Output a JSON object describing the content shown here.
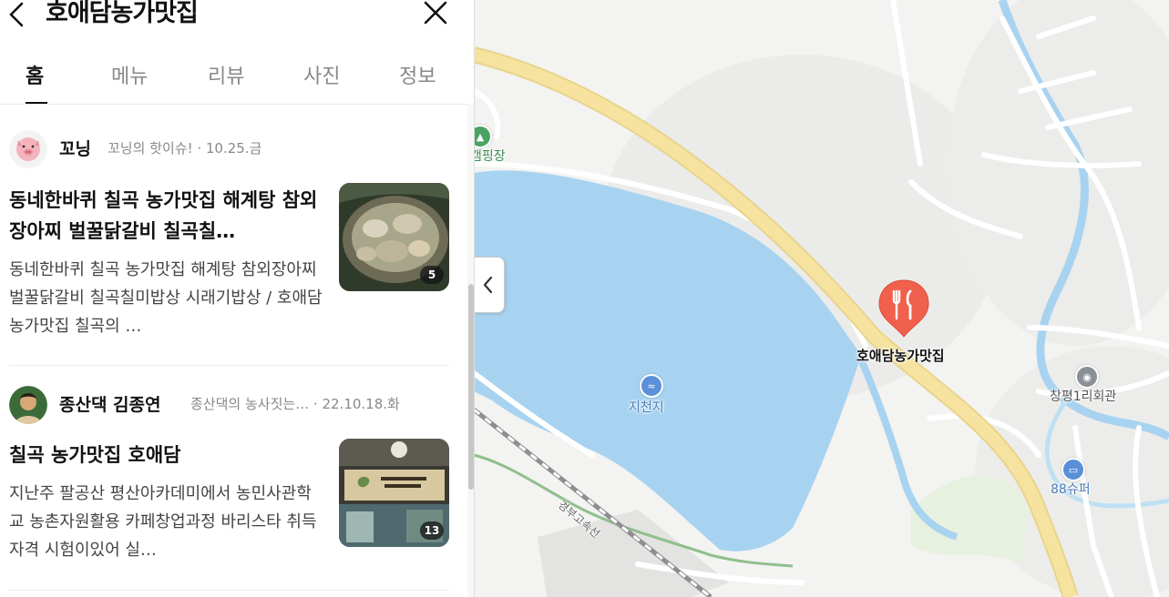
{
  "panel": {
    "title": "호애담농가맛집",
    "tabs": [
      {
        "label": "홈",
        "active": true
      },
      {
        "label": "메뉴",
        "active": false
      },
      {
        "label": "리뷰",
        "active": false
      },
      {
        "label": "사진",
        "active": false
      },
      {
        "label": "정보",
        "active": false
      }
    ],
    "reviews": [
      {
        "author": "꼬닝",
        "subline": "꼬닝의 핫이슈! · 10.25.금",
        "title": "동네한바퀴 칠곡 농가맛집 해계탕 참외장아찌 벌꿀닭갈비 칠곡칠…",
        "body": "동네한바퀴 칠곡 농가맛집 해계탕 참외장아찌 벌꿀닭갈비 칠곡칠미밥상 시래기밥상 / 호애담농가맛집 칠곡의 …",
        "photo_count": "5"
      },
      {
        "author": "종산댁 김종연",
        "subline": "종산댁의 농사짓는… · 22.10.18.화",
        "title": "칠곡 농가맛집 호애담",
        "body": "지난주 팔공산 평산아카데미에서 농민사관학교 농촌자원활용 카페창업과정 바리스타 취득 자격 시험이있어 실…",
        "photo_count": "13"
      }
    ]
  },
  "map": {
    "labels": {
      "camping": "캠핑장",
      "reservoir": "지천지",
      "marker": "호애담농가맛집",
      "hall": "창평1리회관",
      "store": "88슈퍼",
      "expressway": "경부고속선"
    },
    "colors": {
      "water": "#a8d3f0",
      "road_main": "#f6e3a0",
      "marker": "#f0604d",
      "poi_blue": "#5b8fd8",
      "poi_green": "#4aa362"
    }
  },
  "icons": {
    "back": "chevron-left-icon",
    "close": "close-icon",
    "collapse": "chevron-left-icon",
    "marker": "restaurant-fork-knife-icon"
  }
}
